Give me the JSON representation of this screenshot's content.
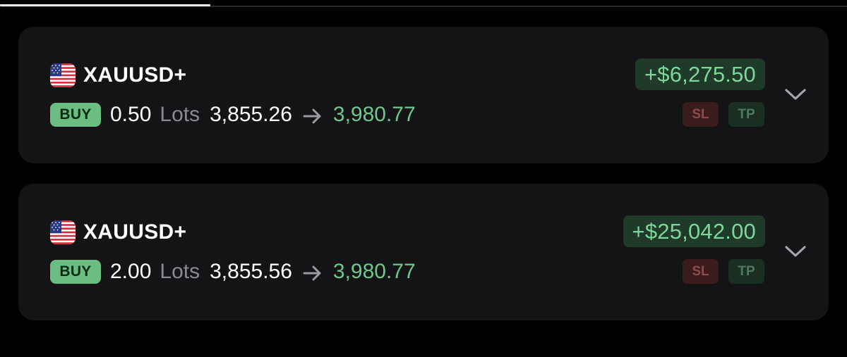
{
  "positions": [
    {
      "symbol": "XAUUSD+",
      "flag_icon": "us-flag-icon",
      "side": "BUY",
      "lots_value": "0.50",
      "lots_label": "Lots",
      "open_price": "3,855.26",
      "current_price": "3,980.77",
      "pnl": "+$6,275.50",
      "sl_label": "SL",
      "tp_label": "TP"
    },
    {
      "symbol": "XAUUSD+",
      "flag_icon": "us-flag-icon",
      "side": "BUY",
      "lots_value": "2.00",
      "lots_label": "Lots",
      "open_price": "3,855.56",
      "current_price": "3,980.77",
      "pnl": "+$25,042.00",
      "sl_label": "SL",
      "tp_label": "TP"
    }
  ],
  "colors": {
    "background": "#000000",
    "card": "#141416",
    "profit": "#6fc78b",
    "buy_badge": "#6bbd82",
    "sl_badge": "#3a1c1c",
    "tp_badge": "#1b2e22"
  }
}
